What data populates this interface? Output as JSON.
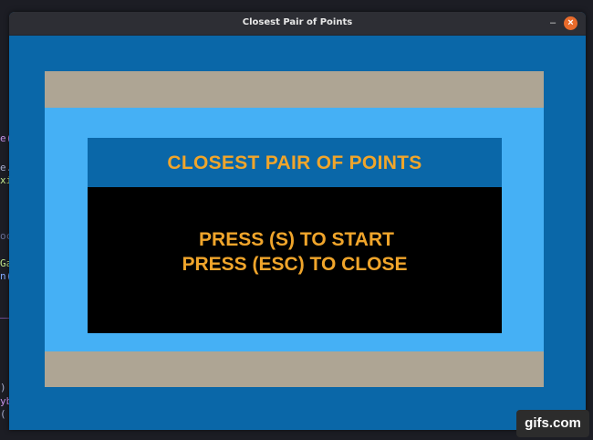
{
  "window": {
    "title": "Closest Pair of Points",
    "minimize_glyph": "–",
    "close_glyph": "×"
  },
  "game": {
    "header": "CLOSEST PAIR OF POINTS",
    "line1": "PRESS (S) TO START",
    "line2": "PRESS (ESC) TO CLOSE"
  },
  "watermark": {
    "text": "gifs.com"
  },
  "background_fragments": [
    "e(",
    "e.",
    "xi",
    "oc",
    "Ga",
    "n(",
    ")",
    "yb",
    "( '"
  ],
  "colors": {
    "window_bg": "#0a67a8",
    "light_blue": "#45b0f5",
    "band": "#aea594",
    "text_orange": "#f0a52b",
    "close_button": "#e96b2b"
  }
}
